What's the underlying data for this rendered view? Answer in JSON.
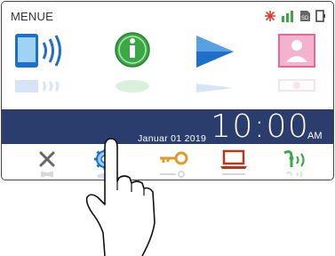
{
  "menu": {
    "title": "MENUE"
  },
  "status_icons": [
    "no-signal-icon",
    "signal-bars-icon",
    "sd-card-icon",
    "device-icon"
  ],
  "apps": [
    {
      "name": "intercom-app",
      "icon": "phone-wireless-icon"
    },
    {
      "name": "info-app",
      "icon": "info-icon"
    },
    {
      "name": "play-app",
      "icon": "play-icon"
    },
    {
      "name": "contact-app",
      "icon": "person-icon"
    }
  ],
  "clock": {
    "date": "Januar 01 2019",
    "time": "10:00",
    "ampm": "AM"
  },
  "tools": [
    {
      "name": "close-tool",
      "icon": "close-icon"
    },
    {
      "name": "settings-tool",
      "icon": "gear-icon"
    },
    {
      "name": "key-tool",
      "icon": "key-icon"
    },
    {
      "name": "laptop-tool",
      "icon": "laptop-icon"
    },
    {
      "name": "door-call-tool",
      "icon": "intercom-icon"
    }
  ],
  "colors": {
    "clock_bar": "#2a3d6c",
    "accent_blue": "#1e6fc7",
    "info_green": "#3aa845",
    "pink": "#e8659a",
    "key_orange": "#e09a2a",
    "status_red": "#e03a2a",
    "status_green": "#3aa845"
  }
}
